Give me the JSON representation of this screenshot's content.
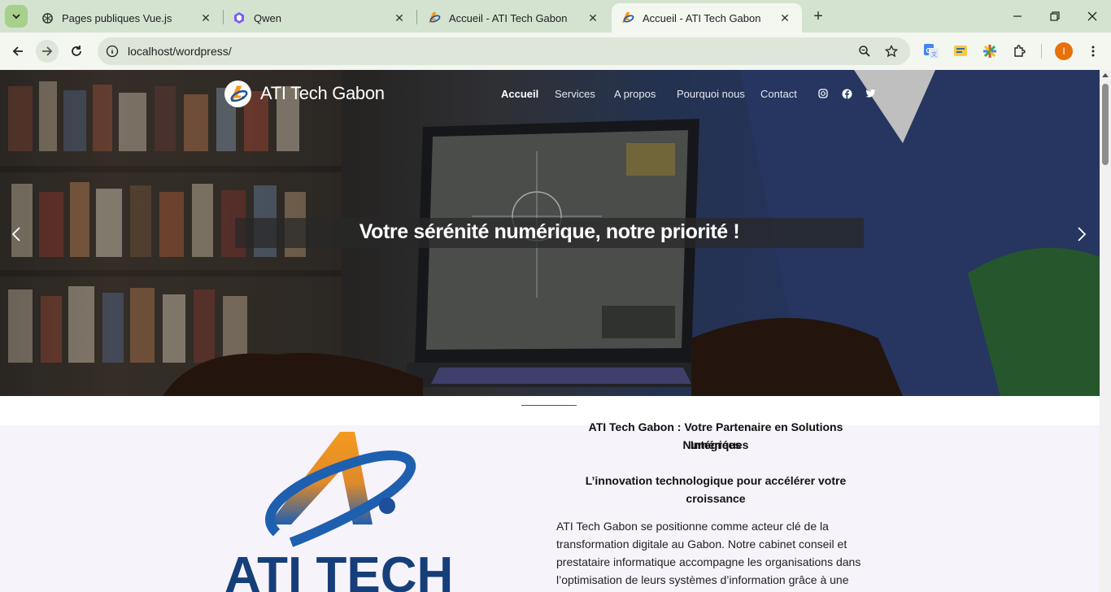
{
  "browser": {
    "tabs": [
      {
        "title": "Pages publiques Vue.js",
        "favicon": "openai-icon",
        "active": false
      },
      {
        "title": "Qwen",
        "favicon": "qwen-icon",
        "active": false
      },
      {
        "title": "Accueil - ATI Tech Gabon",
        "favicon": "ati-tech-icon",
        "active": false
      },
      {
        "title": "Accueil - ATI Tech Gabon",
        "favicon": "ati-tech-icon",
        "active": true
      }
    ],
    "new_tab_label": "+",
    "url": "localhost/wordpress/",
    "profile_initial": "I",
    "colors": {
      "chrome_bg": "#d3e3d0",
      "toolbar_bg": "#f3f7f0",
      "omnibox_bg": "#dde6d8",
      "profile": "#e8710a"
    }
  },
  "site": {
    "brand": "ATI Tech Gabon",
    "nav": [
      {
        "label": "Accueil",
        "active": true
      },
      {
        "label": "Services",
        "active": false
      },
      {
        "label": "A propos",
        "active": false
      },
      {
        "label": "Pourquoi nous",
        "active": false
      },
      {
        "label": "Contact",
        "active": false
      }
    ],
    "social": [
      "instagram-icon",
      "facebook-icon",
      "twitter-icon"
    ],
    "hero": {
      "title": "Votre sérénité numérique, notre priorité !"
    },
    "logo_text": "ATI TECH",
    "headline_line1": "ATI Tech Gabon : Votre Partenaire en Solutions Numériques",
    "headline_line2": "Intégrées",
    "tagline": "L’innovation technologique pour accélérer votre croissance",
    "body_lines": [
      "ATI Tech Gabon se positionne comme acteur clé de la",
      "transformation digitale au Gabon. Notre cabinet conseil et",
      "prestataire informatique accompagne les organisations dans",
      "l’optimisation de leurs systèmes d’information grâce à une"
    ],
    "colors": {
      "brand_blue": "#1e4f9c",
      "brand_orange": "#f39a1e",
      "content_bg": "#f6f3fb"
    }
  }
}
